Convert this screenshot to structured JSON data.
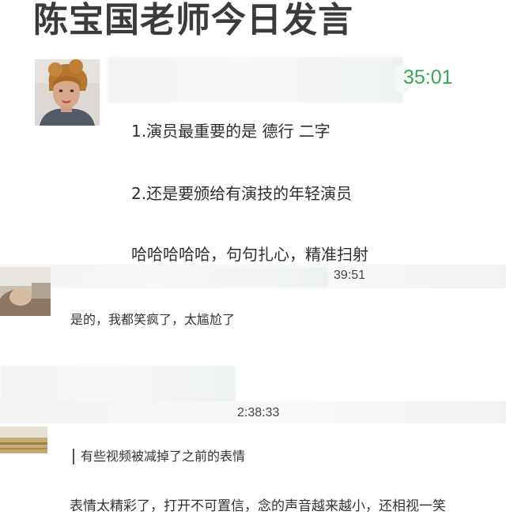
{
  "article": {
    "title": "陈宝国老师今日发言"
  },
  "chat": {
    "first_message_time": "35:01",
    "first_message_lines": [
      "1.演员最重要的是 德行 二字",
      "2.还是要颁给有演技的年轻演员",
      "哈哈哈哈哈，句句扎心，精准扫射"
    ],
    "reply1_time": "39:51",
    "reply1_text": "是的，我都笑疯了，太尴尬了",
    "reply2_time": "2:38:33",
    "reply2_quote": "有些视频被减掉了之前的表情",
    "reply2_text": "表情太精彩了，打开不可置信，念的声音越来越小，还相视一笑"
  },
  "colors": {
    "title": "#3b3b3b",
    "time_green": "#34a853",
    "text": "#2d2d2d"
  }
}
